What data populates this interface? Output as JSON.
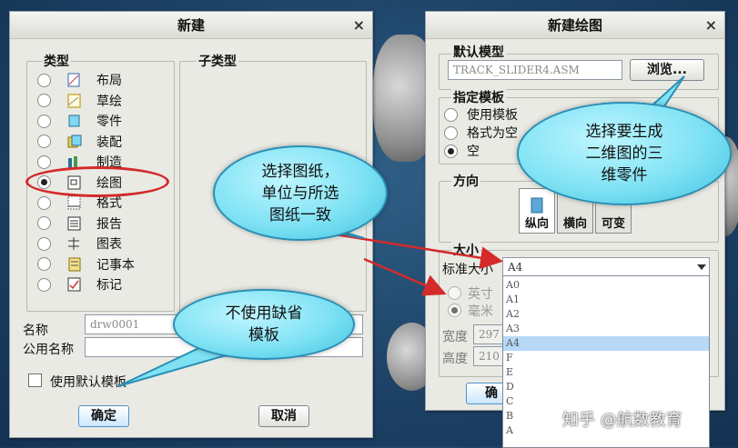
{
  "dialog_new": {
    "title": "新建",
    "close": "×",
    "type_group": "类型",
    "subtype_group": "子类型",
    "types": [
      {
        "label": "布局",
        "icon": "layout-icon",
        "selected": false
      },
      {
        "label": "草绘",
        "icon": "sketch-icon",
        "selected": false
      },
      {
        "label": "零件",
        "icon": "part-icon",
        "selected": false
      },
      {
        "label": "装配",
        "icon": "assembly-icon",
        "selected": false
      },
      {
        "label": "制造",
        "icon": "manufacture-icon",
        "selected": false
      },
      {
        "label": "绘图",
        "icon": "drawing-icon",
        "selected": true
      },
      {
        "label": "格式",
        "icon": "format-icon",
        "selected": false
      },
      {
        "label": "报告",
        "icon": "report-icon",
        "selected": false
      },
      {
        "label": "图表",
        "icon": "diagram-icon",
        "selected": false
      },
      {
        "label": "记事本",
        "icon": "notebook-icon",
        "selected": false
      },
      {
        "label": "标记",
        "icon": "markup-icon",
        "selected": false
      }
    ],
    "name_label": "名称",
    "name_value": "drw0001",
    "common_name_label": "公用名称",
    "common_name_value": "",
    "use_default_template_label": "使用默认模板",
    "ok_label": "确定",
    "cancel_label": "取消"
  },
  "dialog_drawing": {
    "title": "新建绘图",
    "close": "×",
    "default_model_group": "默认模型",
    "default_model_value": "TRACK_SLIDER4.ASM",
    "browse_label": "浏览...",
    "template_group": "指定模板",
    "template_options": [
      {
        "label": "使用模板",
        "selected": false
      },
      {
        "label": "格式为空",
        "selected": false
      },
      {
        "label": "空",
        "selected": true
      }
    ],
    "orientation_group": "方向",
    "orientation_options": [
      "纵向",
      "横向",
      "可变"
    ],
    "size_group": "大小",
    "standard_size_label": "标准大小",
    "standard_size_value": "A4",
    "units": [
      "英寸",
      "毫米"
    ],
    "width_label": "宽度",
    "width_value": "297",
    "height_label": "高度",
    "height_value": "210",
    "ok_label": "确",
    "size_options": [
      "A0",
      "A1",
      "A2",
      "A3",
      "A4",
      "F",
      "E",
      "D",
      "C",
      "B",
      "A"
    ],
    "selected_size": "A4"
  },
  "callouts": {
    "select_paper": "选择图纸，\n单位与所选\n图纸一致",
    "select_model": "选择要生成\n二维图的三\n维零件",
    "no_default_template": "不使用缺省\n模板"
  },
  "watermark": "知乎 @航数教育",
  "colors": {
    "callout_fill": "#7fe2f4",
    "highlight_ellipse": "#d42a2a",
    "arrow": "#d42a2a"
  }
}
